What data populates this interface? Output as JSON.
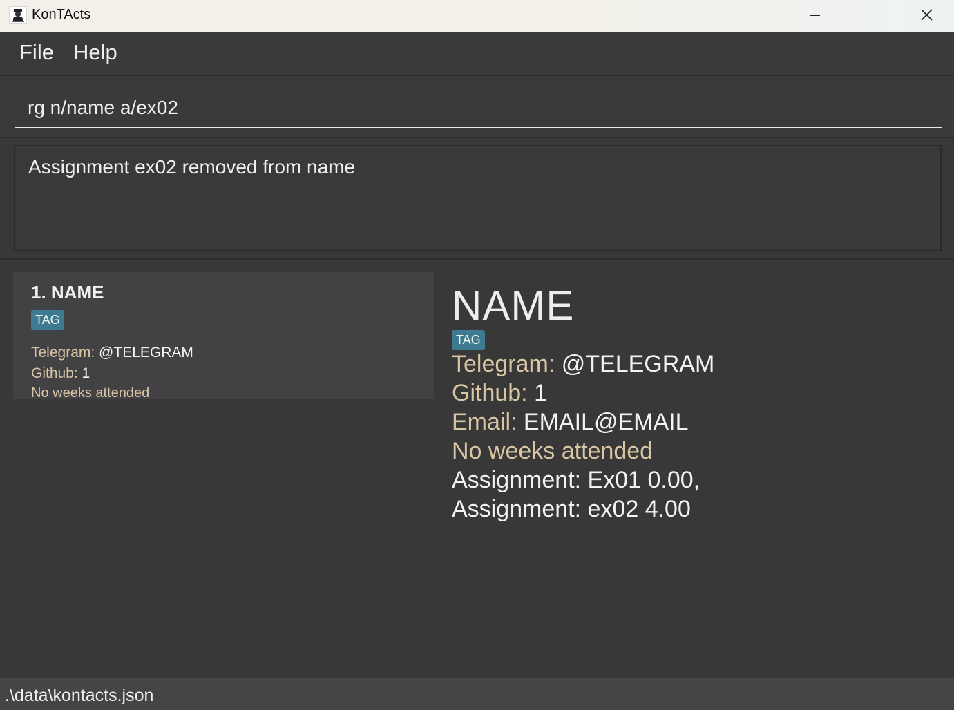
{
  "window": {
    "title": "KonTAct",
    "title_suffix": "s",
    "icon": "kontacts-app-icon",
    "controls": [
      "minimize-icon",
      "maximize-icon",
      "close-icon"
    ]
  },
  "menu": {
    "file_label": "File",
    "help_label": "Help"
  },
  "command": {
    "value": "rg n/name a/ex02"
  },
  "result": {
    "message": "Assignment ex02 removed from name"
  },
  "list": {
    "items": [
      {
        "name": "1. NAME",
        "tag": "TAG",
        "telegram_label": "Telegram: ",
        "telegram_value": "@TELEGRAM",
        "github_label": "Github: ",
        "github_value": "1",
        "attendance": "No weeks attended"
      }
    ]
  },
  "detail": {
    "name": "NAME",
    "tag": "TAG",
    "telegram_label": "Telegram: ",
    "telegram_value": "@TELEGRAM",
    "github_label": "Github: ",
    "github_value": "1",
    "email_label": "Email: ",
    "email_value": "EMAIL@EMAIL",
    "attendance": "No weeks attended",
    "assignments_line1": "Assignment: Ex01 0.00,",
    "assignments_line2": "Assignment: ex02 4.00"
  },
  "status": {
    "file_path": ".\\data\\kontacts.json"
  },
  "colors": {
    "background": "#383838",
    "label": "#d8c5a4",
    "tag": "#3e7b91",
    "text": "#f0f0f0"
  }
}
